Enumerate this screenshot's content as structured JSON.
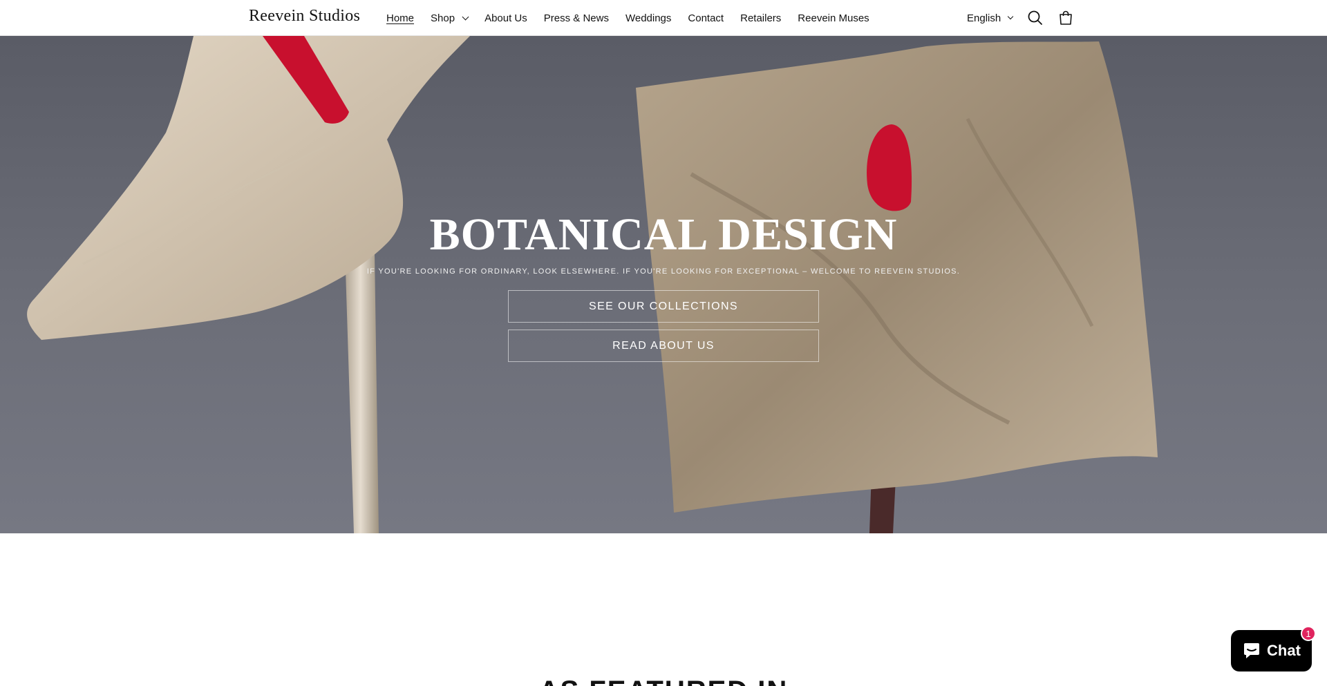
{
  "header": {
    "logo": "Reevein Studios",
    "nav": [
      {
        "label": "Home",
        "active": true
      },
      {
        "label": "Shop",
        "has_dropdown": true
      },
      {
        "label": "About Us"
      },
      {
        "label": "Press & News"
      },
      {
        "label": "Weddings"
      },
      {
        "label": "Contact"
      },
      {
        "label": "Retailers"
      },
      {
        "label": "Reevein Muses"
      }
    ],
    "language": "English",
    "icons": {
      "search": "search-icon",
      "cart": "cart-icon"
    }
  },
  "hero": {
    "title": "BOTANICAL DESIGN",
    "subtitle": "IF YOU'RE LOOKING FOR ORDINARY, LOOK ELSEWHERE. IF YOU'RE LOOKING FOR EXCEPTIONAL – WELCOME TO REEVEIN STUDIOS.",
    "primary_button": "SEE OUR COLLECTIONS",
    "secondary_button": "READ ABOUT US"
  },
  "featured": {
    "heading": "AS FEATURED IN"
  },
  "chat": {
    "label": "Chat",
    "badge": "1"
  },
  "colors": {
    "hero_bg": "#6c6e78",
    "flower_petal": "#c8b9a3",
    "spadix_red": "#c8102e",
    "chat_bg": "#000000",
    "badge": "#e0245e"
  }
}
